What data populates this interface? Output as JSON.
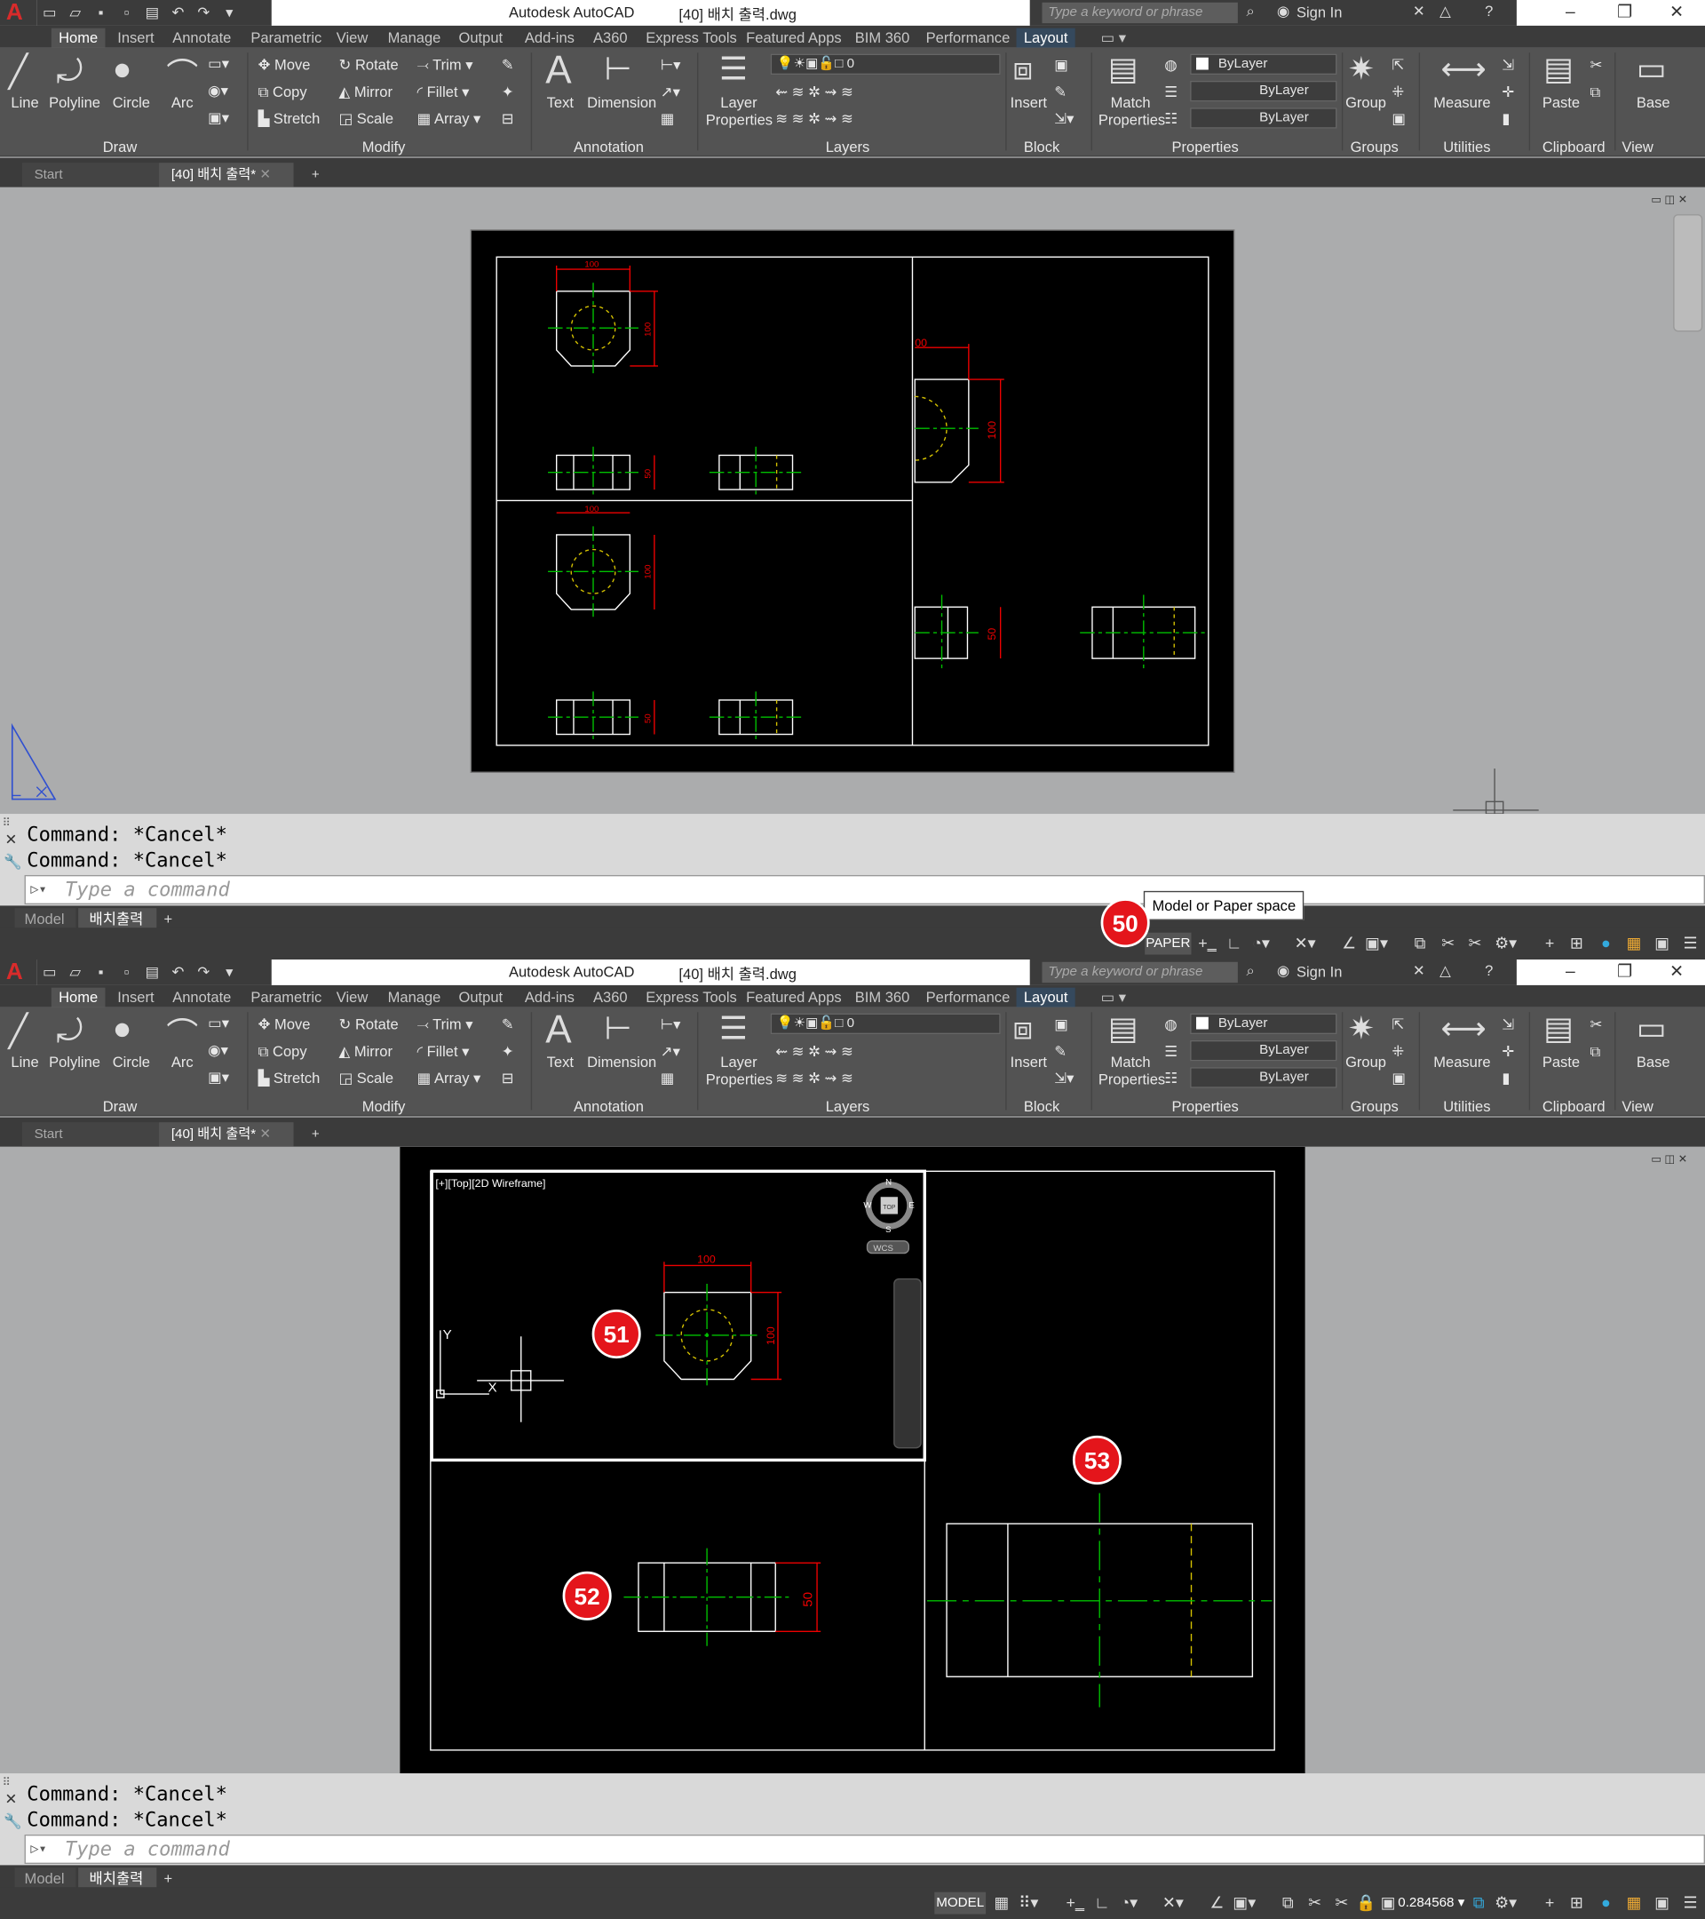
{
  "app": {
    "app_name": "Autodesk AutoCAD",
    "file_name": "[40] 배치 출력.dwg",
    "search_placeholder": "Type a keyword or phrase",
    "sign_in": "Sign In"
  },
  "ribbon_tabs": [
    "Home",
    "Insert",
    "Annotate",
    "Parametric",
    "View",
    "Manage",
    "Output",
    "Add-ins",
    "A360",
    "Express Tools",
    "Featured Apps",
    "BIM 360",
    "Performance",
    "Layout"
  ],
  "ribbon": {
    "draw": {
      "line": "Line",
      "polyline": "Polyline",
      "circle": "Circle",
      "arc": "Arc",
      "label": "Draw"
    },
    "modify": {
      "move": "Move",
      "rotate": "Rotate",
      "trim": "Trim",
      "copy": "Copy",
      "mirror": "Mirror",
      "fillet": "Fillet",
      "stretch": "Stretch",
      "scale": "Scale",
      "array": "Array",
      "label": "Modify"
    },
    "annotation": {
      "text": "Text",
      "dimension": "Dimension",
      "label": "Annotation"
    },
    "layers": {
      "layer_properties_1": "Layer",
      "layer_properties_2": "Properties",
      "current_layer": "0",
      "label": "Layers"
    },
    "block": {
      "insert": "Insert",
      "label": "Block"
    },
    "properties": {
      "match_1": "Match",
      "match_2": "Properties",
      "color": "ByLayer",
      "linetype": "ByLayer",
      "lineweight": "ByLayer",
      "label": "Properties"
    },
    "groups": {
      "group": "Group",
      "label": "Groups"
    },
    "utilities": {
      "measure": "Measure",
      "label": "Utilities"
    },
    "clipboard": {
      "paste": "Paste",
      "label": "Clipboard"
    },
    "view": {
      "base": "Base",
      "label": "View"
    }
  },
  "file_tabs": {
    "start": "Start",
    "document": "[40] 배치 출력*"
  },
  "command": {
    "history_1": "Command: *Cancel*",
    "history_2": "Command: *Cancel*",
    "placeholder": "Type a command"
  },
  "layout_tabs": {
    "model": "Model",
    "layout": "배치출력",
    "add": "+"
  },
  "status": {
    "top_space": "PAPER",
    "bottom_space": "MODEL",
    "scale": "0.284568",
    "tooltip": "Model or Paper space"
  },
  "viewport": {
    "label": "[+][Top][2D Wireframe]",
    "compass_n": "N",
    "compass_s": "S",
    "compass_e": "E",
    "compass_w": "W",
    "cube_top": "TOP",
    "wcs": "WCS",
    "ucs_x": "X",
    "ucs_y": "Y"
  },
  "dims": {
    "d100": "100",
    "d50": "50",
    "d00": "00"
  },
  "badges": {
    "b50": "50",
    "b51": "51",
    "b52": "52",
    "b53": "53"
  },
  "colors": {
    "accent": "#e4151b",
    "dim_red": "#ff0000",
    "center_green": "#00c000",
    "hidden_yellow": "#d4c100"
  }
}
